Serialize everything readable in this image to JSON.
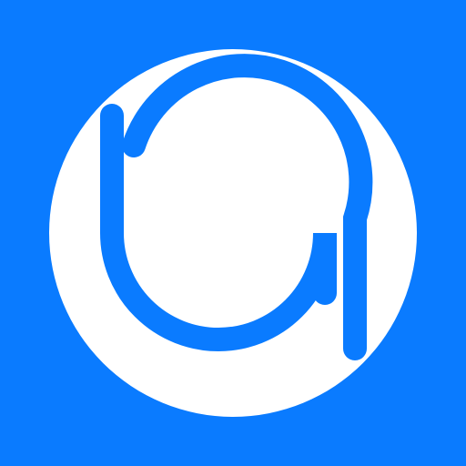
{
  "icon": {
    "name": "ba-monogram-logo-icon",
    "colors": {
      "background": "#0A7BFF",
      "disc": "#FFFFFF",
      "mark": "#0A7BFF"
    }
  }
}
